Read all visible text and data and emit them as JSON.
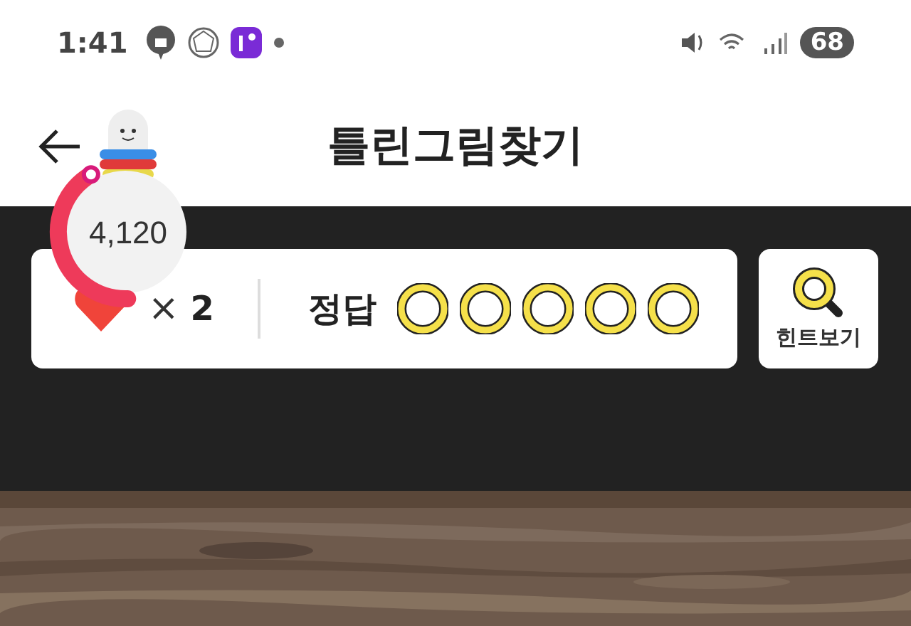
{
  "status_bar": {
    "time": "1:41",
    "battery": "68"
  },
  "header": {
    "title": "틀린그림찾기"
  },
  "score": {
    "points": "4,120"
  },
  "lives": {
    "sign": "×",
    "count": "2"
  },
  "answers": {
    "label": "정답",
    "marks": [
      {
        "found": false
      },
      {
        "found": false
      },
      {
        "found": false
      },
      {
        "found": false
      },
      {
        "found": false
      }
    ]
  },
  "hint_button": {
    "label": "힌트보기"
  }
}
